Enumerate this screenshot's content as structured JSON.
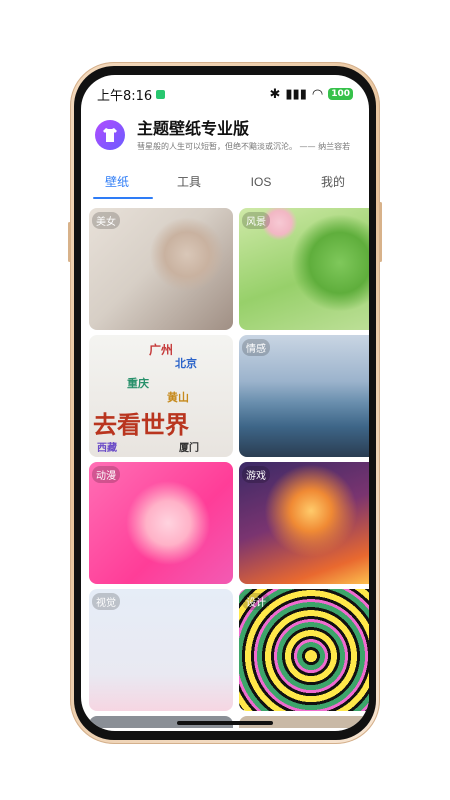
{
  "status": {
    "time": "上午8:16",
    "battery": "100"
  },
  "header": {
    "title": "主题壁纸专业版",
    "subtitle": "彗星般的人生可以短暂，但绝不黯淡或沉沦。 —— 纳兰容若"
  },
  "tabs": [
    "壁纸",
    "工具",
    "IOS",
    "我的"
  ],
  "tiles": [
    {
      "label": "美女"
    },
    {
      "label": "风景"
    },
    {
      "label": ""
    },
    {
      "label": "情感"
    },
    {
      "label": "动漫"
    },
    {
      "label": "游戏"
    },
    {
      "label": "视觉"
    },
    {
      "label": "设计"
    }
  ],
  "tile3_words": [
    "广州",
    "北京",
    "重庆",
    "黄山",
    "去看世界",
    "厦门",
    "西藏"
  ],
  "colors": {
    "accent": "#2e7cf6",
    "battery": "#36c14a",
    "logo": "#8a55ff"
  },
  "icons": [
    "app-logo-icon",
    "bluetooth-icon",
    "signal-icon",
    "wifi-icon",
    "battery-icon"
  ]
}
